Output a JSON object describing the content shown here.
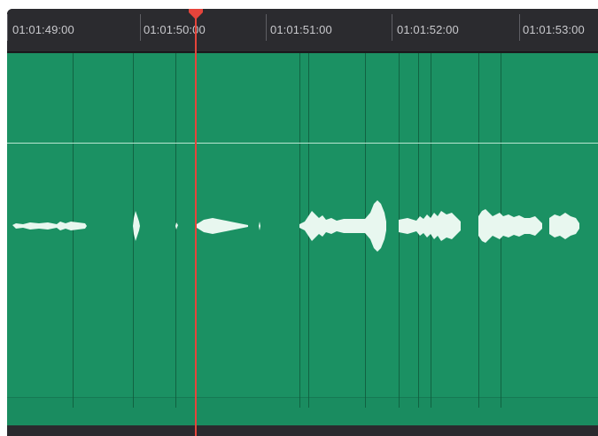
{
  "timeline": {
    "ruler": {
      "timecodes": [
        "01:01:49:00",
        "01:01:50:00",
        "01:01:51:00",
        "01:01:52:00",
        "01:01:53:00"
      ]
    },
    "playhead": {
      "current_position_label": "01:01:50:00"
    },
    "audio_clip": {
      "color": "#1b9163",
      "waveform_color": "#e8f7ef"
    },
    "colors": {
      "playhead": "#e6443b",
      "ruler_background": "#2b2b2f"
    }
  }
}
